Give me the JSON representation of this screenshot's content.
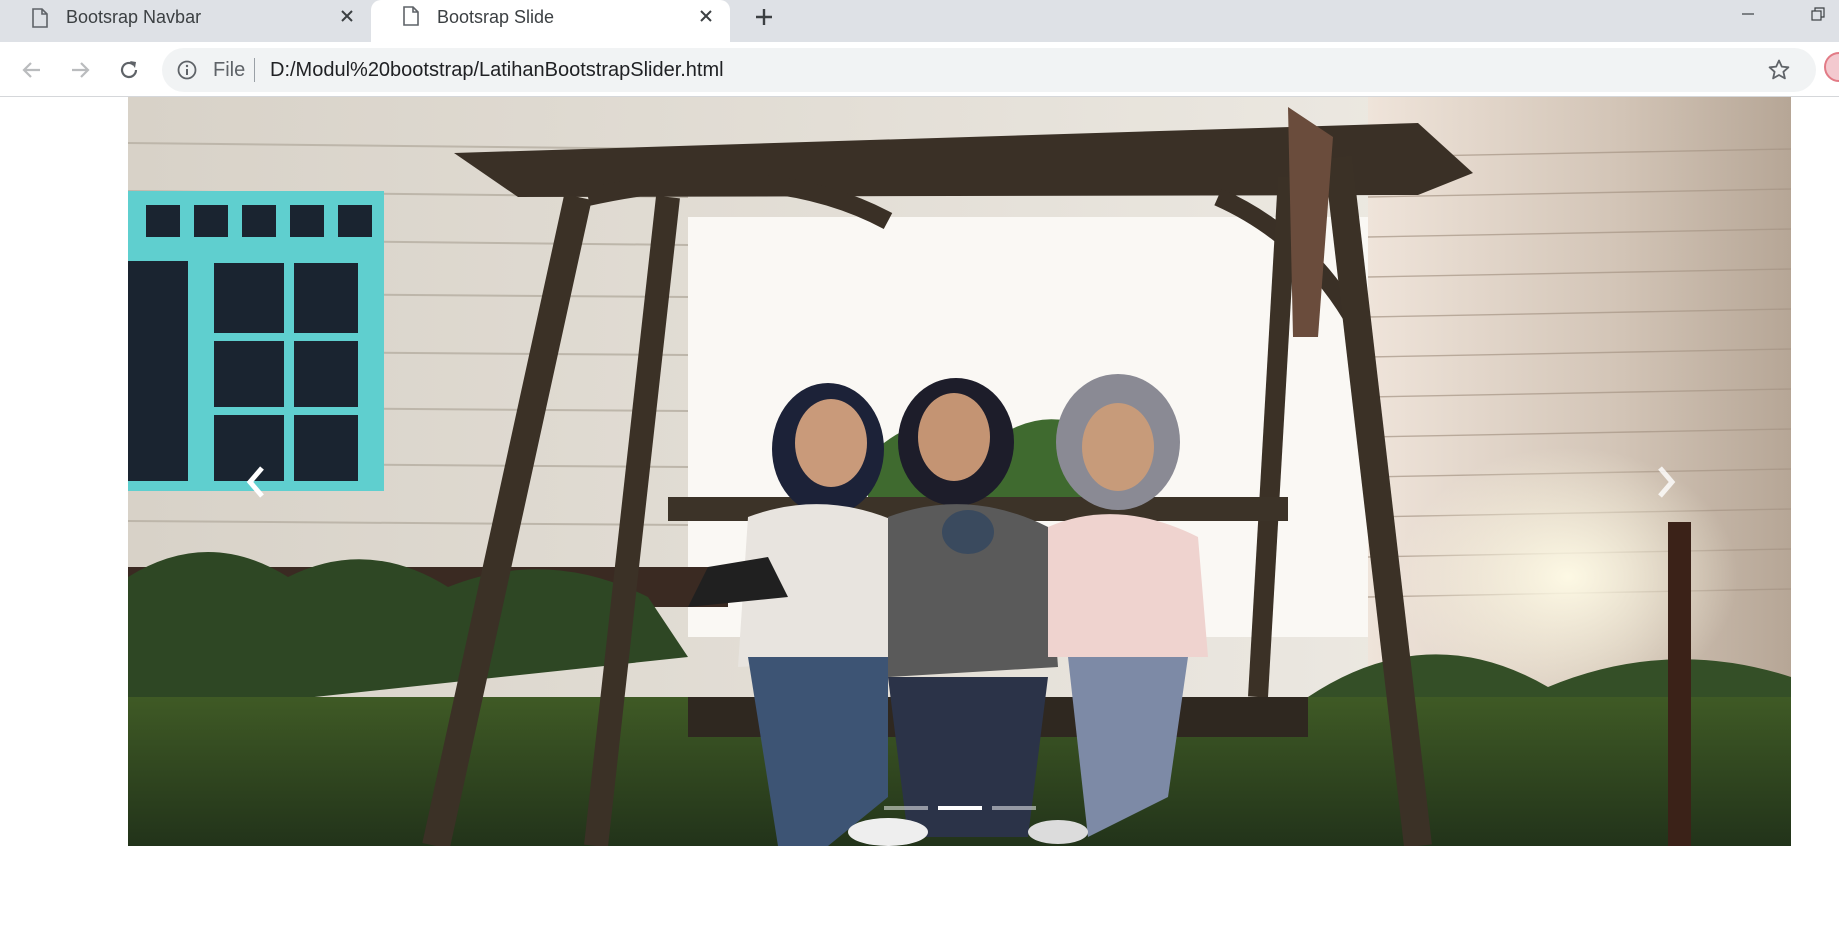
{
  "browser": {
    "tabs": [
      {
        "title": "Bootsrap Navbar",
        "active": false
      },
      {
        "title": "Bootsrap Slide",
        "active": true
      }
    ],
    "address": {
      "scheme_label": "File",
      "url": "D:/Modul%20bootstrap/LatihanBootstrapSlider.html"
    },
    "icons": {
      "back": "arrow-left-icon",
      "forward": "arrow-right-icon",
      "reload": "reload-icon",
      "info": "info-icon",
      "bookmark": "star-icon",
      "new_tab": "plus-icon",
      "close_tab": "close-icon",
      "page": "document-icon"
    }
  },
  "carousel": {
    "slide_count": 3,
    "active_index": 1,
    "slide_image": "Three girls in hijabs sitting on a wooden porch swing in a garden at night",
    "controls": {
      "prev": "chevron-left-icon",
      "next": "chevron-right-icon"
    },
    "colors": {
      "indicator_active": "#ffffff",
      "indicator_inactive": "rgba(255,255,255,0.5)"
    }
  }
}
